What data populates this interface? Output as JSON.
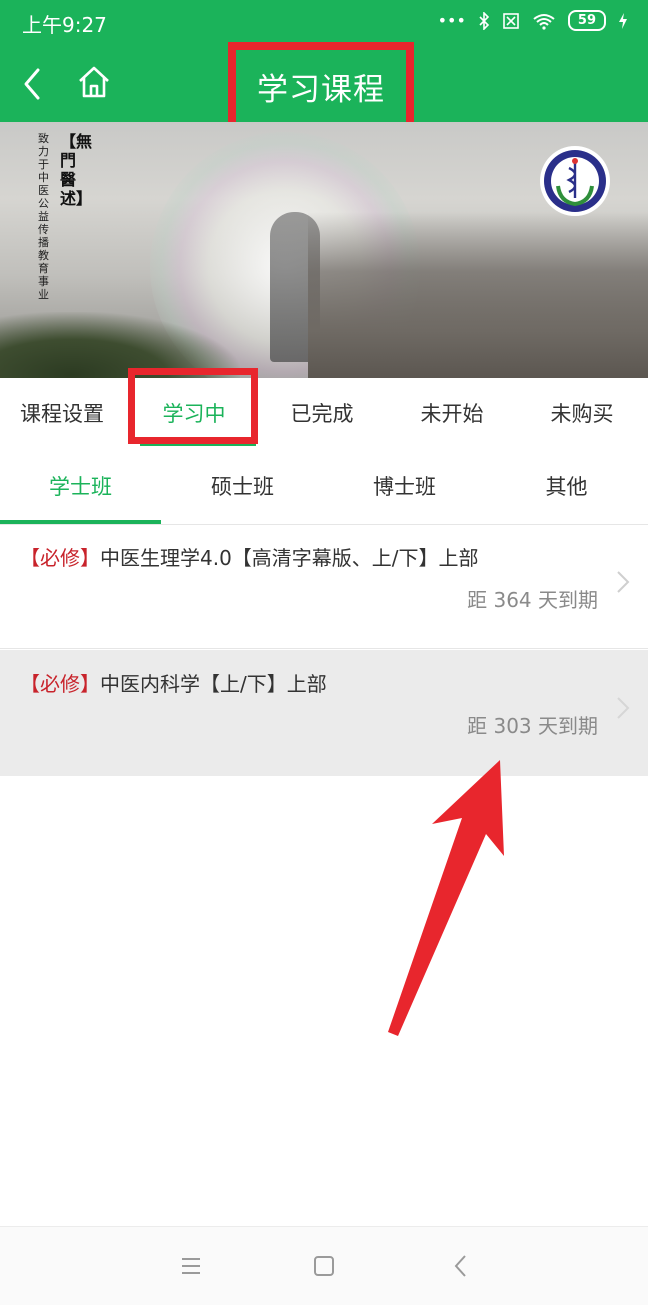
{
  "status_bar": {
    "time": "上午9:27",
    "battery": "59",
    "icons": [
      "more-dots-icon",
      "bluetooth-icon",
      "sim-off-icon",
      "wifi-icon",
      "battery-icon",
      "charging-icon"
    ]
  },
  "header": {
    "title": "学习课程",
    "accent_color": "#1bb35a",
    "highlight_color": "#e8262d"
  },
  "banner": {
    "brand": "【無門醫述】",
    "tagline": "致力于中医公益传播教育事业",
    "logo_text": "無門醫述"
  },
  "course_tabs": [
    "课程设置",
    "学习中",
    "已完成",
    "未开始",
    "未购买"
  ],
  "class_tabs": [
    "学士班",
    "硕士班",
    "博士班",
    "其他"
  ],
  "courses": [
    {
      "tag": "【必修】",
      "title": "中医生理学4.0【高清字幕版、上/下】上部",
      "expiry": "距 364 天到期"
    },
    {
      "tag": "【必修】",
      "title": "中医内科学【上/下】上部",
      "expiry": "距 303 天到期"
    }
  ],
  "nav": [
    "menu-icon",
    "home-square-icon",
    "back-triangle-icon"
  ]
}
